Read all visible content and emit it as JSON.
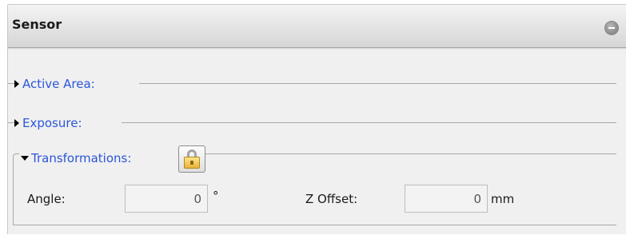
{
  "panel": {
    "title": "Sensor",
    "collapse_icon": "minus-circle-icon"
  },
  "sections": {
    "active_area": {
      "label": "Active Area:",
      "expanded": false
    },
    "exposure": {
      "label": "Exposure:",
      "expanded": false
    },
    "transformations": {
      "label": "Transformations:",
      "expanded": true,
      "lock_icon": "padlock-icon"
    }
  },
  "fields": {
    "angle": {
      "label": "Angle:",
      "value": "0",
      "unit": "°"
    },
    "z_offset": {
      "label": "Z Offset:",
      "value": "0",
      "unit": "mm"
    }
  },
  "colors": {
    "section_label": "#2b56d8",
    "panel_bg": "#f0f0f0",
    "header_bg": "#dedede"
  }
}
